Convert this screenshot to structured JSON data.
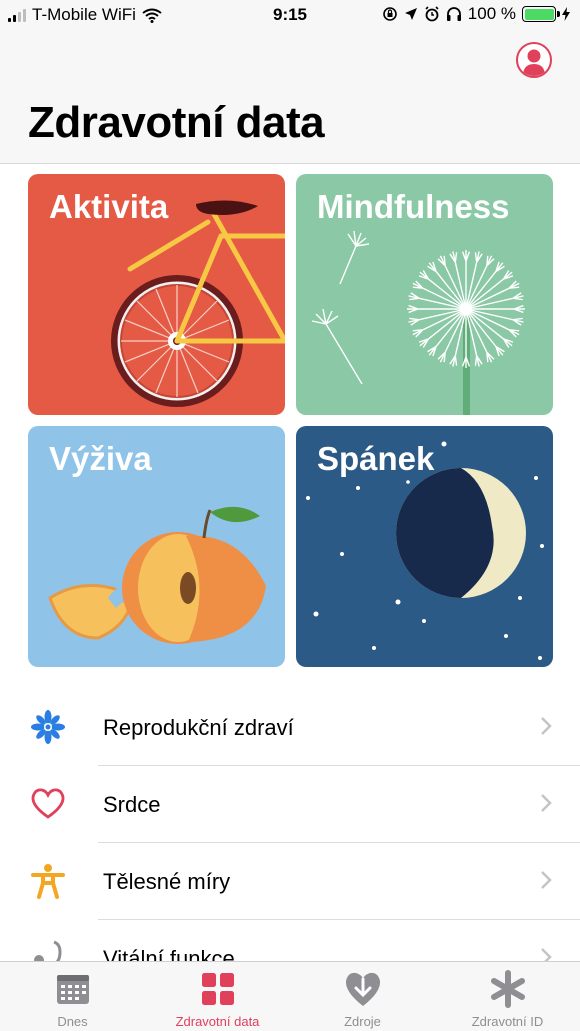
{
  "status_bar": {
    "carrier": "T-Mobile WiFi",
    "time": "9:15",
    "battery": "100 %"
  },
  "header": {
    "title": "Zdravotní data",
    "profile_icon": "person-icon"
  },
  "categories": [
    {
      "label": "Aktivita",
      "color": "#e55a45",
      "icon": "bicycle-icon"
    },
    {
      "label": "Mindfulness",
      "color": "#8ac8a6",
      "icon": "dandelion-icon"
    },
    {
      "label": "Výživa",
      "color": "#8fc3e8",
      "icon": "peach-icon"
    },
    {
      "label": "Spánek",
      "color": "#2c5a86",
      "icon": "moon-icon"
    }
  ],
  "list": [
    {
      "label": "Reprodukční zdraví",
      "icon": "snowflake-icon"
    },
    {
      "label": "Srdce",
      "icon": "heart-icon"
    },
    {
      "label": "Tělesné míry",
      "icon": "body-icon"
    },
    {
      "label": "Vitální funkce",
      "icon": "stethoscope-icon"
    }
  ],
  "tabs": [
    {
      "label": "Dnes",
      "icon": "calendar-icon",
      "active": false
    },
    {
      "label": "Zdravotní data",
      "icon": "grid-icon",
      "active": true
    },
    {
      "label": "Zdroje",
      "icon": "download-heart-icon",
      "active": false
    },
    {
      "label": "Zdravotní ID",
      "icon": "asterisk-icon",
      "active": false
    }
  ],
  "accent_color": "#e0405a"
}
